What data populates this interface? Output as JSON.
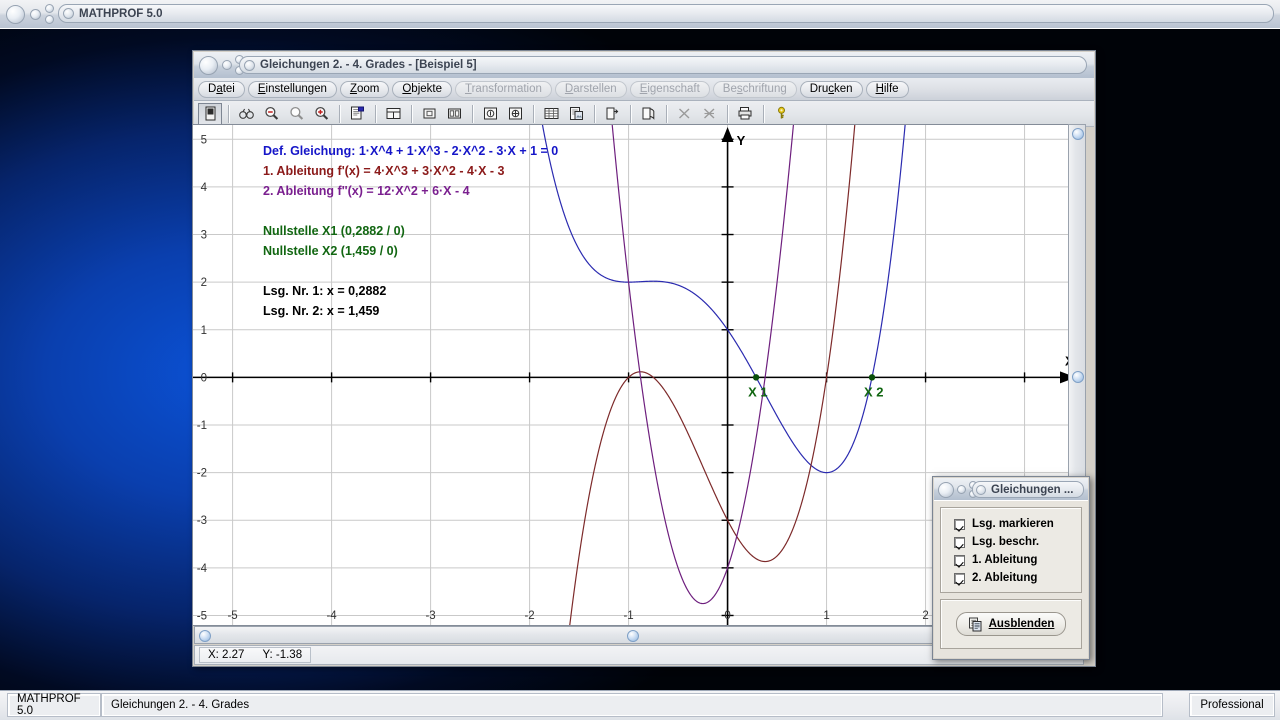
{
  "app": {
    "title": "MATHPROF 5.0",
    "status_left": "MATHPROF 5.0",
    "status_mid": "Gleichungen 2. - 4. Grades",
    "status_right": "Professional"
  },
  "window": {
    "title": "Gleichungen 2. - 4. Grades - [Beispiel 5]",
    "menu": [
      {
        "label": "Datei",
        "enabled": true
      },
      {
        "label": "Einstellungen",
        "enabled": true
      },
      {
        "label": "Zoom",
        "enabled": true
      },
      {
        "label": "Objekte",
        "enabled": true
      },
      {
        "label": "Transformation",
        "enabled": false
      },
      {
        "label": "Darstellen",
        "enabled": false
      },
      {
        "label": "Eigenschaft",
        "enabled": false
      },
      {
        "label": "Beschriftung",
        "enabled": false
      },
      {
        "label": "Drucken",
        "enabled": true
      },
      {
        "label": "Hilfe",
        "enabled": true
      }
    ],
    "toolbar": [
      {
        "name": "mode-toggle-icon",
        "pressed": true
      },
      {
        "name": "separator"
      },
      {
        "name": "binoculars-icon"
      },
      {
        "name": "zoom-out-icon"
      },
      {
        "name": "zoom-reset-icon"
      },
      {
        "name": "zoom-in-icon"
      },
      {
        "name": "separator"
      },
      {
        "name": "properties-icon"
      },
      {
        "name": "separator"
      },
      {
        "name": "layout-split-icon"
      },
      {
        "name": "separator"
      },
      {
        "name": "single-panel-icon"
      },
      {
        "name": "dual-panel-icon"
      },
      {
        "name": "separator"
      },
      {
        "name": "info-circle-icon"
      },
      {
        "name": "target-circle-icon"
      },
      {
        "name": "separator"
      },
      {
        "name": "table-icon"
      },
      {
        "name": "document-image-icon"
      },
      {
        "name": "separator"
      },
      {
        "name": "export-icon"
      },
      {
        "name": "separator"
      },
      {
        "name": "copy-pages-icon"
      },
      {
        "name": "separator"
      },
      {
        "name": "clear-one-icon"
      },
      {
        "name": "clear-all-icon"
      },
      {
        "name": "separator"
      },
      {
        "name": "print-icon"
      },
      {
        "name": "separator"
      },
      {
        "name": "help-key-icon"
      }
    ],
    "coord_status": {
      "x_label": "X: 2.27",
      "y_label": "Y: -1.38"
    }
  },
  "dialog": {
    "title": "Gleichungen ...",
    "checkboxes": [
      {
        "label": "Lsg. markieren",
        "checked": true
      },
      {
        "label": "Lsg. beschr.",
        "checked": true
      },
      {
        "label": "1. Ableitung",
        "checked": true
      },
      {
        "label": "2. Ableitung",
        "checked": true
      }
    ],
    "hide_button": "Ausblenden"
  },
  "chart_data": {
    "type": "line",
    "title": "",
    "xlabel": "X",
    "ylabel": "Y",
    "xlim": [
      -5.4,
      3.55
    ],
    "ylim": [
      -5.2,
      5.3
    ],
    "grid": true,
    "xticks": [
      -5,
      -4,
      -3,
      -2,
      -1,
      0,
      1,
      2,
      3
    ],
    "yticks": [
      5,
      4,
      3,
      2,
      1,
      0,
      -1,
      -2,
      -3,
      -4,
      -5
    ],
    "annotations": [
      {
        "text": "Def. Gleichung: 1·X^4 + 1·X^3 - 2·X^2 - 3·X + 1 = 0",
        "color": "#1515c8"
      },
      {
        "text": "1. Ableitung f'(x) = 4·X^3 + 3·X^2 - 4·X - 3",
        "color": "#8b1a1a"
      },
      {
        "text": "2. Ableitung f''(x) = 12·X^2 + 6·X - 4",
        "color": "#7a1f8f"
      },
      {
        "text": "Nullstelle X1 (0,2882 / 0)",
        "color": "#116611"
      },
      {
        "text": "Nullstelle X2 (1,459 / 0)",
        "color": "#116611"
      },
      {
        "text": "Lsg. Nr. 1: x = 0,2882",
        "color": "#000000"
      },
      {
        "text": "Lsg. Nr. 2: x = 1,459",
        "color": "#000000"
      }
    ],
    "series": [
      {
        "name": "f(x) = x^4 + x^3 - 2x^2 - 3x + 1",
        "color": "#2b2bb0",
        "expr": "quartic"
      },
      {
        "name": "f'(x) = 4x^3 + 3x^2 - 4x - 3",
        "color": "#7d2a2a",
        "expr": "cubic"
      },
      {
        "name": "f''(x) = 12x^2 + 6x - 4",
        "color": "#6e1f7e",
        "expr": "quadratic"
      }
    ],
    "roots": [
      {
        "label": "X 1",
        "x": 0.2882,
        "y": 0,
        "color": "#116611"
      },
      {
        "label": "X 2",
        "x": 1.459,
        "y": 0,
        "color": "#116611"
      }
    ]
  }
}
